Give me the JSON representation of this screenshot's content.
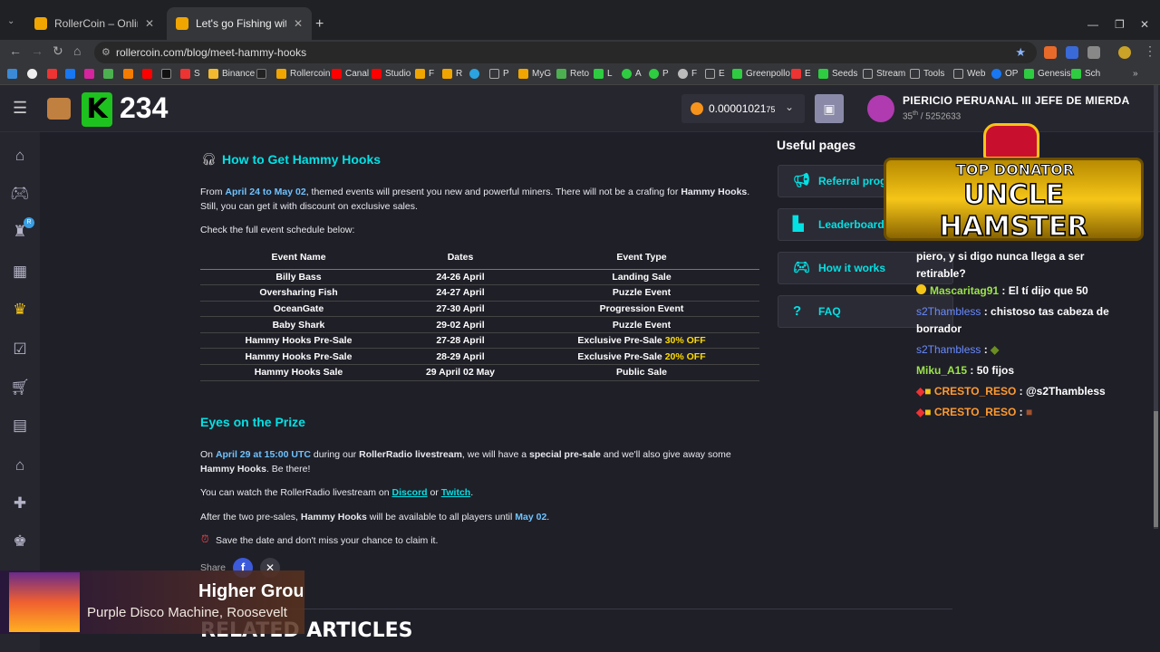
{
  "browser": {
    "tabs": [
      {
        "title": "RollerCoin – Online Bitcoin Mini",
        "active": false
      },
      {
        "title": "Let's go Fishing with Hammy H",
        "active": true
      }
    ],
    "url": "rollercoin.com/blog/meet-hammy-hooks",
    "bookmarks": [
      "S",
      "Binance",
      "Rollercoin",
      "Canal",
      "Studio",
      "F",
      "R",
      "P",
      "MyG",
      "Reto",
      "L",
      "A",
      "P",
      "F",
      "E",
      "Greenpollo",
      "E",
      "Seeds",
      "Stream",
      "Tools",
      "Web",
      "OP",
      "Genesis",
      "Sch"
    ]
  },
  "header": {
    "level": "234",
    "balance": "0.00001021",
    "balance_small": "75",
    "username": "PIERICIO PERUANAL III JEFE DE MIERDA",
    "rank_text": "35",
    "rank_sup": "th",
    "rank_total": " / 5252633"
  },
  "sidebar_badge": "R",
  "article": {
    "section1_title": "How to Get Hammy Hooks",
    "p1": {
      "a": "From ",
      "b": "April 24 to May 02",
      "c": ", themed events will present you new and powerful miners. There will not be a crafing for ",
      "d": "Hammy Hooks",
      "e": ". Still, you can get it with discount on exclusive sales."
    },
    "p2": "Check the full event schedule below:",
    "table": {
      "headers": [
        "Event Name",
        "Dates",
        "Event Type"
      ],
      "rows": [
        {
          "name": "Billy Bass",
          "dates": "24-26 April",
          "type": "Landing Sale",
          "off": ""
        },
        {
          "name": "Oversharing Fish",
          "dates": "24-27 April",
          "type": "Puzzle Event",
          "off": ""
        },
        {
          "name": "OceanGate",
          "dates": "27-30 April",
          "type": "Progression Event",
          "off": ""
        },
        {
          "name": "Baby Shark",
          "dates": "29-02 April",
          "type": "Puzzle Event",
          "off": ""
        },
        {
          "name": "Hammy Hooks Pre-Sale",
          "dates": "27-28 April",
          "type": "Exclusive Pre-Sale ",
          "off": "30% OFF"
        },
        {
          "name": "Hammy Hooks Pre-Sale",
          "dates": "28-29 April",
          "type": "Exclusive Pre-Sale ",
          "off": "20% OFF"
        },
        {
          "name": "Hammy Hooks Sale",
          "dates": "29 April 02 May",
          "type": "Public Sale",
          "off": ""
        }
      ]
    },
    "section2_title": "Eyes on the Prize",
    "p3": {
      "a": "On ",
      "b": "April 29 at 15:00 UTC",
      "c": " during our ",
      "d": "RollerRadio livestream",
      "e": ", we will have a ",
      "f": "special pre-sale",
      "g": " and we'll also give away some ",
      "h": "Hammy Hooks",
      "i": ". Be there!"
    },
    "p4": {
      "a": "You can watch the RollerRadio livestream on ",
      "b": "Discord",
      "c": " or ",
      "d": "Twitch",
      "e": "."
    },
    "p5": {
      "a": "After the two pre-sales, ",
      "b": "Hammy Hooks",
      "c": " will be available to all players until ",
      "d": "May 02",
      "e": "."
    },
    "p6": "Save the date and don't miss your chance to claim it.",
    "share": "Share",
    "related": "RELATED ARTICLES"
  },
  "useful": {
    "title": "Useful pages",
    "items": [
      "Referral prog",
      "Leaderboard",
      "How it works",
      "FAQ"
    ]
  },
  "donator": {
    "line1": "TOP DONATOR",
    "line2": "UNCLE HAMSTER"
  },
  "chat": [
    {
      "user": "",
      "text": "piero, y si digo nunca llega a ser retirable?",
      "ucolor": "#ffffff"
    },
    {
      "user": "Mascaritag91",
      "text": " : El tí dijo que 50",
      "ucolor": "#9be34a"
    },
    {
      "user": "s2Thambless",
      "text": " : chistoso tas cabeza de borrador",
      "ucolor": "#6a8cff"
    },
    {
      "user": "s2Thambless",
      "text": " : ",
      "ucolor": "#6a8cff"
    },
    {
      "user": "Miku_A15",
      "text": " : 50 fijos",
      "ucolor": "#9be34a"
    },
    {
      "user": "CRESTO_RESO",
      "text": " : @s2Thambless",
      "ucolor": "#ff9a2e"
    },
    {
      "user": "CRESTO_RESO",
      "text": " : ",
      "ucolor": "#ff9a2e"
    }
  ],
  "music": {
    "title": "Higher Grou",
    "artist": "Purple Disco Machine, Roosevelt"
  }
}
